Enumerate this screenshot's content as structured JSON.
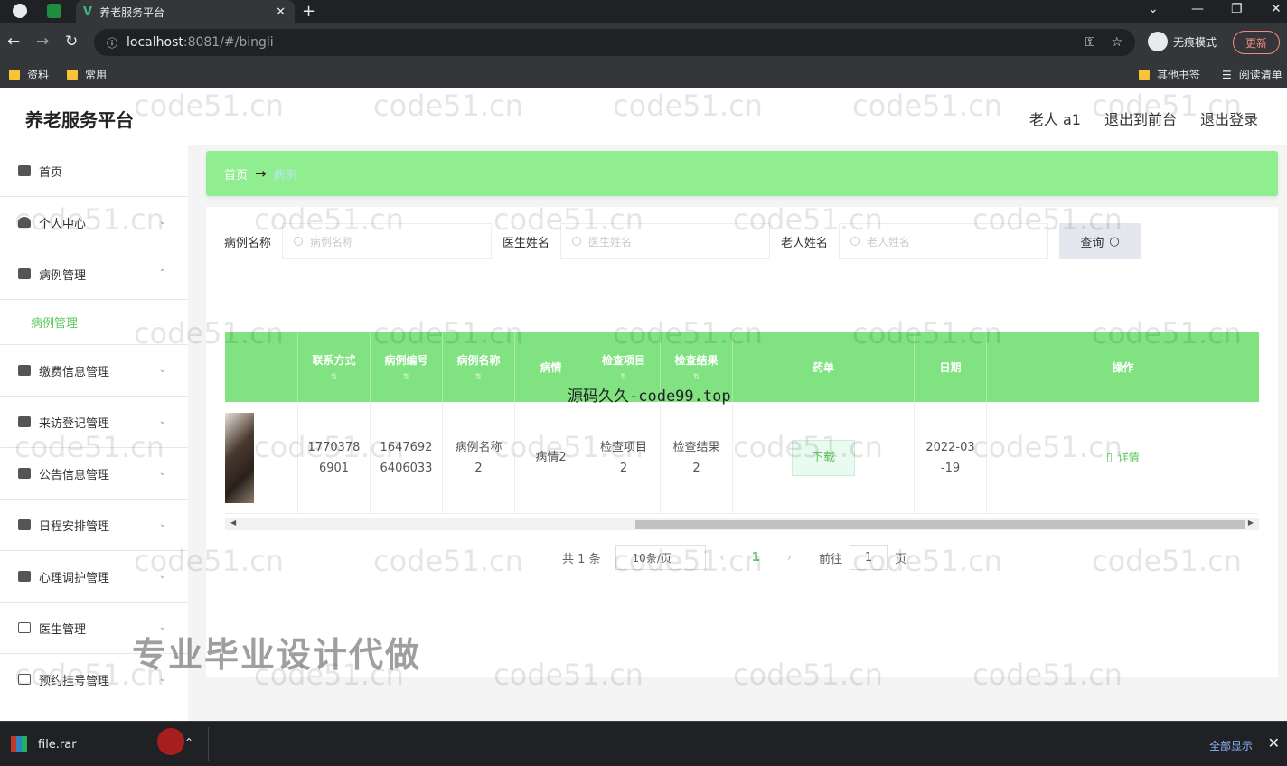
{
  "browser": {
    "tab_title": "养老服务平台",
    "tab_close": "✕",
    "new_tab": "+",
    "url_host": "localhost",
    "url_rest": ":8081/#/bingli",
    "incognito_label": "无痕模式",
    "update_label": "更新",
    "bookmarks": [
      "资料",
      "常用"
    ],
    "bookmarks_right": [
      "其他书签",
      "阅读清单"
    ]
  },
  "header": {
    "brand": "养老服务平台",
    "links": [
      "老人 a1",
      "退出到前台",
      "退出登录"
    ]
  },
  "sidebar": {
    "items": [
      {
        "label": "首页"
      },
      {
        "label": "个人中心"
      },
      {
        "label": "病例管理"
      },
      {
        "label": "缴费信息管理"
      },
      {
        "label": "来访登记管理"
      },
      {
        "label": "公告信息管理"
      },
      {
        "label": "日程安排管理"
      },
      {
        "label": "心理调护管理"
      },
      {
        "label": "医生管理"
      },
      {
        "label": "预约挂号管理"
      }
    ],
    "active_sub": "病例管理"
  },
  "breadcrumb": {
    "home": "首页",
    "arrow": "→",
    "current": "病例"
  },
  "search": {
    "case_label": "病例名称",
    "case_placeholder": "病例名称",
    "doctor_label": "医生姓名",
    "doctor_placeholder": "医生姓名",
    "elder_label": "老人姓名",
    "elder_placeholder": "老人姓名",
    "query_button": "查询"
  },
  "table": {
    "headers": [
      "联系方式",
      "病例编号",
      "病例名称",
      "病情",
      "检查项目",
      "检查结果",
      "药单",
      "日期",
      "操作"
    ],
    "row": {
      "phone": [
        "1770378",
        "6901"
      ],
      "case_no": [
        "1647692",
        "6406033"
      ],
      "case_name": [
        "病例名称",
        "2"
      ],
      "condition": "病情2",
      "exam_item": [
        "检查项目",
        "2"
      ],
      "exam_result": [
        "检查结果",
        "2"
      ],
      "download": "下载",
      "date": [
        "2022-03",
        "-19"
      ],
      "detail": "详情"
    }
  },
  "pager": {
    "total": "共 1 条",
    "page_size": "10条/页",
    "current": "1",
    "goto": "前往",
    "goto_value": "1",
    "page_unit": "页"
  },
  "watermarks": {
    "site": "code51.cn",
    "source": "源码久久-code99.top",
    "promo": "专业毕业设计代做"
  },
  "download_bar": {
    "file": "file.rar",
    "show_all": "全部显示",
    "close": "✕"
  }
}
